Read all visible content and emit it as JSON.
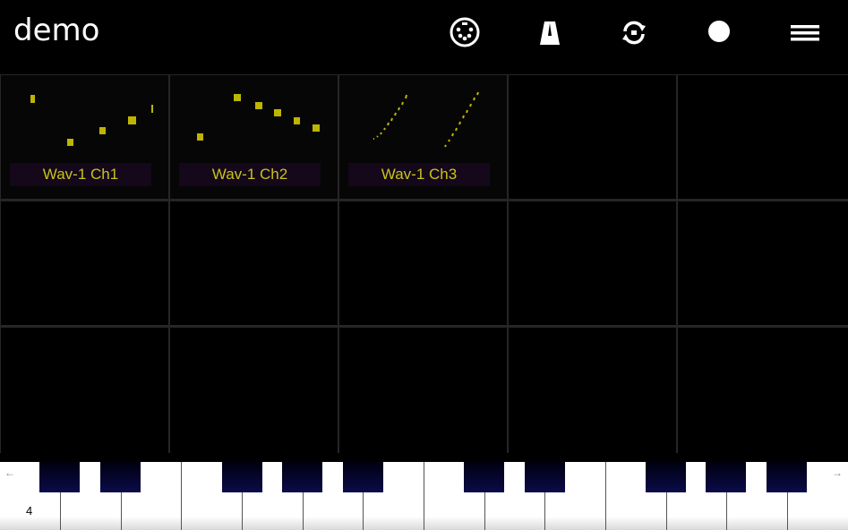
{
  "app": {
    "title": "demo"
  },
  "toolbar": {
    "midi_icon": "midi-connector-icon",
    "metronome_icon": "metronome-icon",
    "sync_icon": "sync-icon",
    "record_icon": "record-icon",
    "menu_icon": "menu-icon"
  },
  "clips": [
    {
      "label": "Wav-1 Ch1"
    },
    {
      "label": "Wav-1 Ch2"
    },
    {
      "label": "Wav-1 Ch3"
    }
  ],
  "keyboard": {
    "octave_label": "4",
    "left_arrow": "←",
    "right_arrow": "→"
  },
  "colors": {
    "accent": "#bdb500",
    "label_bg": "#14081a",
    "black_key": "#0b0b4a"
  }
}
